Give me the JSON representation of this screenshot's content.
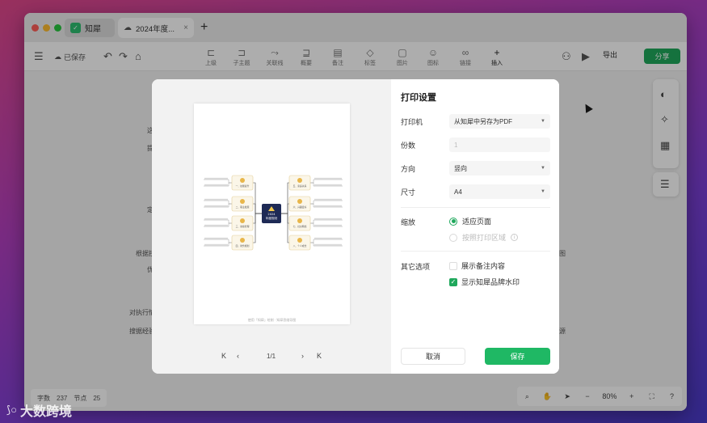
{
  "tabs": {
    "app_label": "知犀",
    "doc_label": "2024年度...",
    "close_glyph": "×",
    "new_glyph": "+"
  },
  "toolbar": {
    "saved_label": "已保存",
    "tools": [
      {
        "label": "上级",
        "icon": "parent-node-icon"
      },
      {
        "label": "子主题",
        "icon": "child-node-icon"
      },
      {
        "label": "关联线",
        "icon": "relation-line-icon"
      },
      {
        "label": "概要",
        "icon": "summary-icon"
      },
      {
        "label": "备注",
        "icon": "note-icon"
      },
      {
        "label": "标签",
        "icon": "tag-icon"
      },
      {
        "label": "图片",
        "icon": "image-icon"
      },
      {
        "label": "图标",
        "icon": "emoji-icon"
      },
      {
        "label": "链接",
        "icon": "link-icon"
      },
      {
        "label": "插入",
        "icon": "insert-icon"
      }
    ],
    "export_label": "导出",
    "share_label": "分享"
  },
  "canvas": {
    "bg_texts": [
      "这",
      "提",
      "定",
      "根据技",
      "优",
      "对执行情",
      "搜据经验",
      "图",
      "源"
    ]
  },
  "footer": {
    "word_count_label": "字数",
    "word_count": "237",
    "node_count_label": "节点",
    "node_count": "25",
    "zoom": "80%",
    "zoom_minus": "−",
    "zoom_plus": "+"
  },
  "preview": {
    "center_topic": [
      "2024",
      "年度规划"
    ],
    "left_nodes": [
      "一、技能提升",
      "二、职业发展",
      "三、健康管理",
      "四、财务规划"
    ],
    "right_nodes": [
      "五、家庭关系",
      "六、兴趣爱好",
      "七、社交网络",
      "八、个人成长"
    ],
    "page_footer": "使用「知犀」绘制 · 知犀思维导图",
    "page_indicator": "1/1"
  },
  "settings": {
    "title": "打印设置",
    "printer_label": "打印机",
    "printer_value": "从知犀中另存为PDF",
    "copies_label": "份数",
    "copies_value": "1",
    "orientation_label": "方向",
    "orientation_value": "竖向",
    "size_label": "尺寸",
    "size_value": "A4",
    "scale_label": "缩放",
    "scale_fit": "适应页面",
    "scale_area": "按照打印区域",
    "other_label": "其它选项",
    "opt_notes": "展示备注内容",
    "opt_notes_checked": false,
    "opt_watermark": "显示知犀品牌水印",
    "opt_watermark_checked": true,
    "cancel_label": "取消",
    "save_label": "保存"
  },
  "watermark": {
    "text": "大数跨境"
  },
  "colors": {
    "brand_green": "#1fa85c",
    "center_node": "#1e2a55",
    "node_fill": "#fbf6e8",
    "node_border": "#e3cf99"
  }
}
